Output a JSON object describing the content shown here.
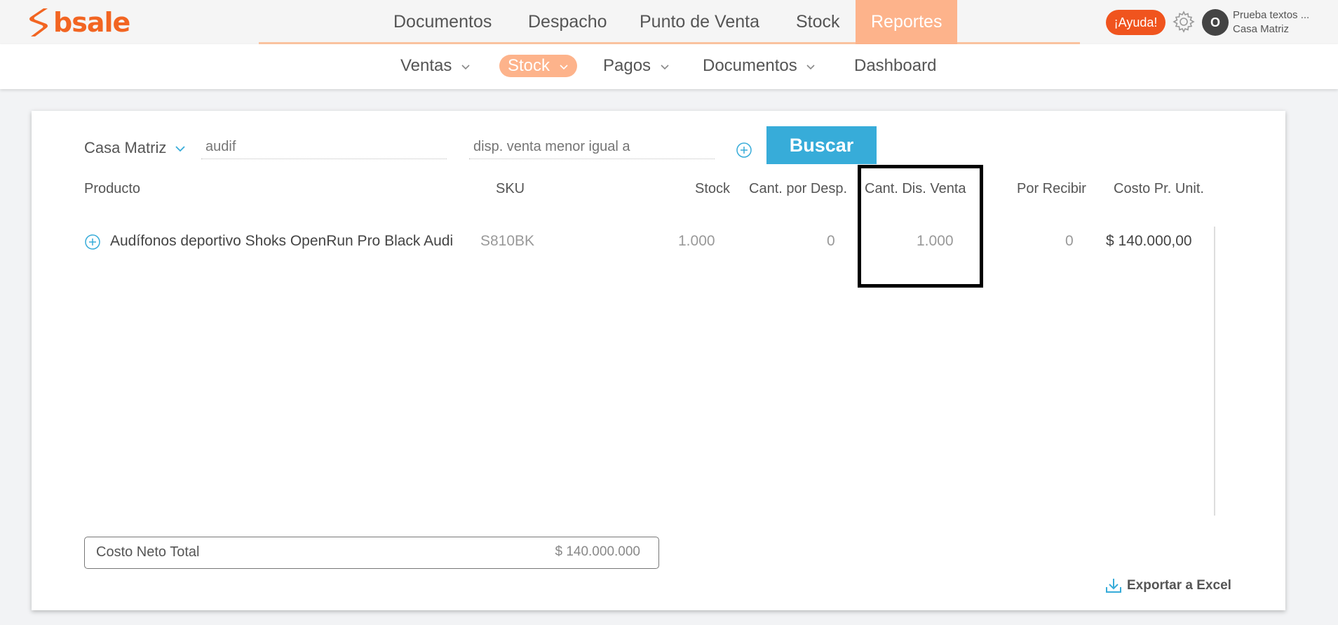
{
  "brand": {
    "name": "bsale",
    "color": "#f26522"
  },
  "main_nav": {
    "items": [
      {
        "label": "Documentos"
      },
      {
        "label": "Despacho"
      },
      {
        "label": "Punto de Venta"
      },
      {
        "label": "Stock"
      },
      {
        "label": "Reportes",
        "active": true
      }
    ]
  },
  "header_right": {
    "help_label": "¡Ayuda!",
    "avatar_initial": "O",
    "user_name": "Prueba textos ...",
    "user_branch": "Casa Matriz"
  },
  "sub_nav": {
    "items": [
      {
        "label": "Ventas"
      },
      {
        "label": "Stock",
        "active": true
      },
      {
        "label": "Pagos"
      },
      {
        "label": "Documentos"
      },
      {
        "label": "Dashboard"
      }
    ]
  },
  "filters": {
    "branch": "Casa Matriz",
    "search_value": "audif",
    "filter_placeholder": "disp. venta menor igual a",
    "search_button": "Buscar"
  },
  "table": {
    "headers": {
      "product": "Producto",
      "sku": "SKU",
      "stock": "Stock",
      "cant_desp": "Cant. por Desp.",
      "cant_dis_venta": "Cant. Dis. Venta",
      "por_recibir": "Por Recibir",
      "costo_unit": "Costo Pr. Unit."
    },
    "rows": [
      {
        "product": "Audífonos deportivo Shoks OpenRun Pro Black Audi",
        "sku": "S810BK",
        "stock": "1.000",
        "cant_desp": "0",
        "cant_dis_venta": "1.000",
        "por_recibir": "0",
        "costo_unit": "$ 140.000,00"
      }
    ]
  },
  "totals": {
    "label": "Costo Neto Total",
    "value": "$ 140.000.000"
  },
  "export_label": "Exportar a Excel",
  "colors": {
    "accent_orange": "#f0541e",
    "active_tab": "#fdb38b",
    "button_blue": "#37acd9"
  }
}
